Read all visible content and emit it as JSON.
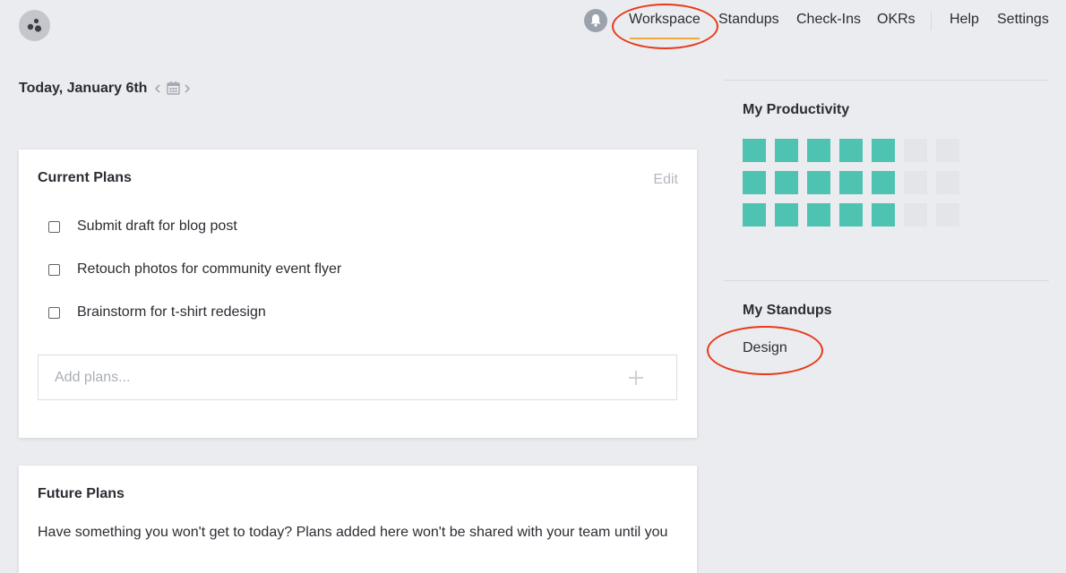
{
  "nav": {
    "items": [
      {
        "label": "Workspace",
        "active": true
      },
      {
        "label": "Standups"
      },
      {
        "label": "Check-Ins"
      },
      {
        "label": "OKRs"
      },
      {
        "label": "Help"
      },
      {
        "label": "Settings"
      }
    ]
  },
  "date": {
    "title": "Today, January 6th"
  },
  "current_plans": {
    "title": "Current Plans",
    "edit_label": "Edit",
    "items": [
      {
        "text": "Submit draft for blog post",
        "checked": false
      },
      {
        "text": "Retouch photos for community event flyer",
        "checked": false
      },
      {
        "text": "Brainstorm for t-shirt redesign",
        "checked": false
      }
    ],
    "add_placeholder": "Add plans..."
  },
  "future_plans": {
    "title": "Future Plans",
    "description": "Have something you won't get to today? Plans added here won't be shared with your team until you"
  },
  "productivity": {
    "title": "My Productivity",
    "filled_color": "#4fc3b1",
    "empty_color": "#e3e5e8",
    "rows": [
      [
        true,
        true,
        true,
        true,
        true,
        false,
        false
      ],
      [
        true,
        true,
        true,
        true,
        true,
        false,
        false
      ],
      [
        true,
        true,
        true,
        true,
        true,
        false,
        false
      ]
    ]
  },
  "standups": {
    "title": "My Standups",
    "items": [
      "Design"
    ]
  },
  "colors": {
    "accent": "#f0a93a",
    "annotation": "#e8391a"
  }
}
